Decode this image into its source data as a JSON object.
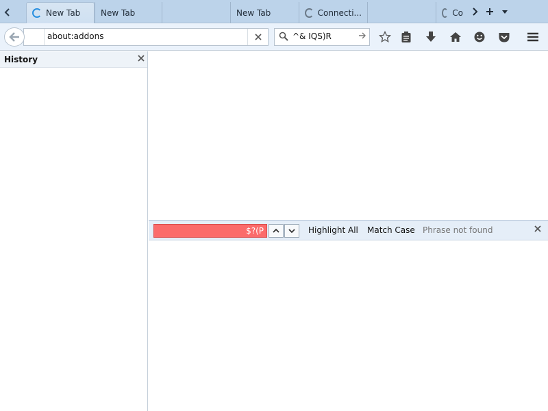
{
  "tabs": [
    {
      "label": "New Tab",
      "state": "loading-blue",
      "active": true
    },
    {
      "label": "New Tab",
      "state": "none",
      "active": false
    },
    {
      "label": "New Tab",
      "state": "none",
      "active": false
    },
    {
      "label": "Connecti...",
      "state": "loading-gray",
      "active": false
    },
    {
      "label": "Co",
      "state": "loading-gray",
      "active": false
    }
  ],
  "navbar": {
    "url": "about:addons",
    "search_query": "^& IQS)R"
  },
  "sidebar": {
    "title": "History"
  },
  "findbar": {
    "query": "$?(P",
    "highlight_all": "Highlight All",
    "match_case": "Match Case",
    "status": "Phrase not found"
  },
  "icons": {
    "tab_scroll_left": "chevron-left-icon",
    "tab_scroll_right": "chevron-right-icon",
    "new_tab": "plus-icon",
    "all_tabs": "caret-down-icon",
    "back": "back-arrow-icon",
    "clear_url": "close-icon",
    "search": "magnifier-icon",
    "search_go": "arrow-right-icon",
    "bookmark": "star-icon",
    "reading_list": "clipboard-icon",
    "downloads": "download-arrow-icon",
    "home": "home-icon",
    "hello": "smiley-icon",
    "pocket": "pocket-icon",
    "menu": "hamburger-menu-icon"
  }
}
